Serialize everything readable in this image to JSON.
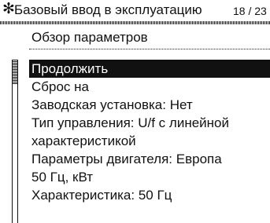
{
  "header": {
    "star_glyph": "✻",
    "title": "Базовый ввод в эксплуатацию",
    "page_indicator": "18 / 23"
  },
  "section": {
    "title": "Обзор параметров"
  },
  "menu": {
    "items": [
      {
        "label": "Продолжить",
        "selected": true
      },
      {
        "label": "Сброс на",
        "selected": false
      },
      {
        "label": "Заводская установка: Нет",
        "selected": false
      },
      {
        "label": "Тип управления: U/f с линейной",
        "selected": false
      },
      {
        "label": "характеристикой",
        "selected": false
      },
      {
        "label": "Параметры двигателя: Европа",
        "selected": false
      },
      {
        "label": "50 Гц, кВт",
        "selected": false
      },
      {
        "label": "Характеристика: 50 Гц",
        "selected": false
      }
    ]
  },
  "colors": {
    "background": "#ffffff",
    "text": "#111111",
    "selection_background": "#111111",
    "selection_text": "#ffffff"
  }
}
